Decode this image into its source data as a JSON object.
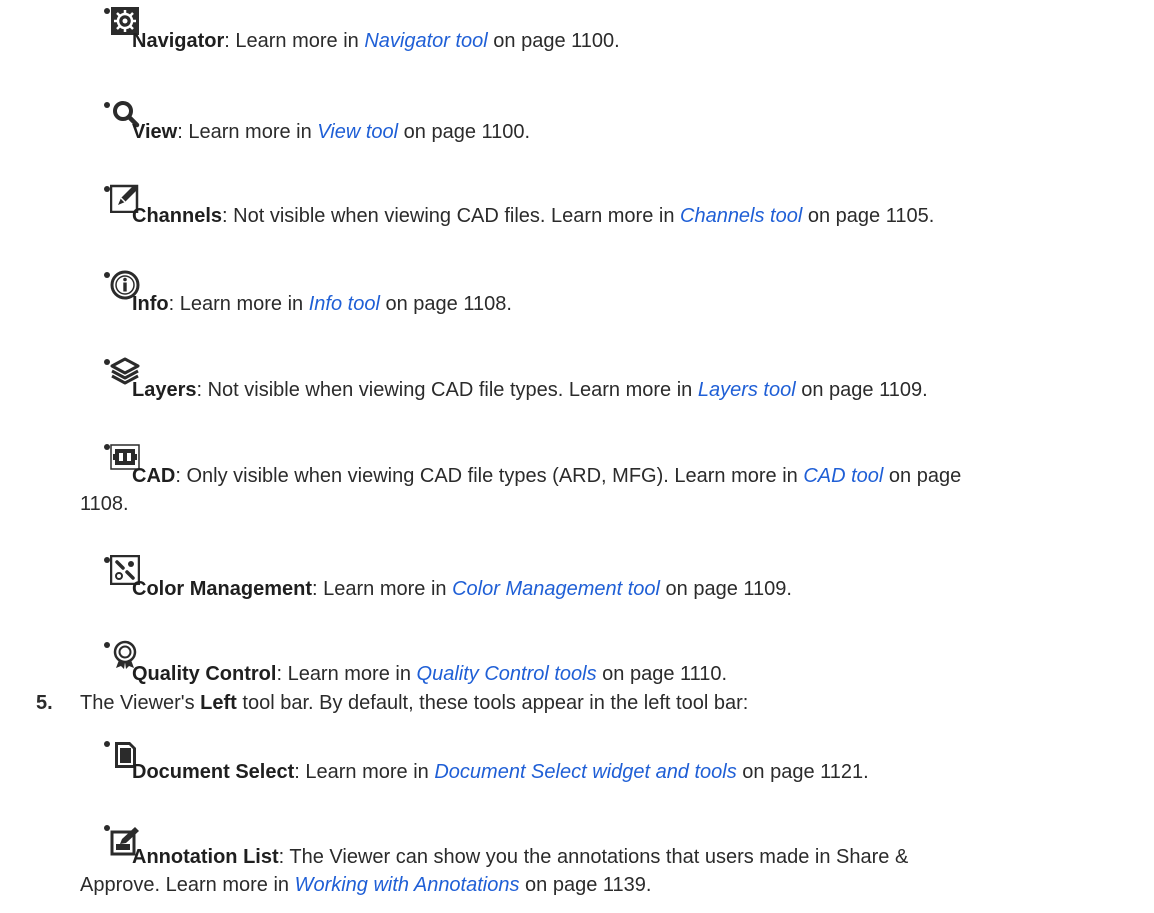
{
  "items": [
    {
      "term": "Navigator",
      "pre": ": Learn more in ",
      "link": "Navigator tool",
      "post": " on page 1100.",
      "icon": "navigator-icon"
    },
    {
      "term": "View",
      "pre": ": Learn more in ",
      "link": "View tool",
      "post": " on page 1100.",
      "icon": "view-magnifier-icon"
    },
    {
      "term": "Channels",
      "pre": ": Not visible when viewing CAD files. Learn more in ",
      "link": "Channels tool",
      "post": " on page 1105.",
      "icon": "channels-pencil-icon"
    },
    {
      "term": "Info",
      "pre": ": Learn more in ",
      "link": "Info tool",
      "post": " on page 1108.",
      "icon": "info-icon"
    },
    {
      "term": "Layers",
      "pre": ": Not visible when viewing CAD file types. Learn more in ",
      "link": "Layers tool",
      "post": " on page 1109.",
      "icon": "layers-icon"
    },
    {
      "term": "CAD",
      "pre": ": Only visible when viewing CAD file types (ARD, MFG). Learn more in ",
      "link": "CAD tool",
      "post": " on page",
      "cont": "1108.",
      "icon": "cad-icon"
    },
    {
      "term": "Color Management",
      "pre": ": Learn more in ",
      "link": "Color Management tool",
      "post": " on page 1109.",
      "icon": "color-management-icon"
    },
    {
      "term": "Quality Control",
      "pre": ": Learn more in ",
      "link": "Quality Control tools",
      "post": " on page 1110.",
      "icon": "quality-control-icon"
    }
  ],
  "step5": {
    "number": "5.",
    "pre": "The Viewer's ",
    "term": "Left",
    "post": " tool bar. By default, these tools appear in the left tool bar:"
  },
  "subitems": [
    {
      "term": "Document Select",
      "pre": ": Learn more in ",
      "link": "Document Select widget and tools",
      "post": " on page 1121.",
      "icon": "document-select-icon"
    },
    {
      "term": "Annotation List",
      "pre": ": The Viewer can show you the annotations that users made in Share &",
      "cont_pre": "Approve. Learn more in ",
      "link": "Working with Annotations",
      "post": " on page 1139.",
      "icon": "annotation-list-icon"
    }
  ]
}
